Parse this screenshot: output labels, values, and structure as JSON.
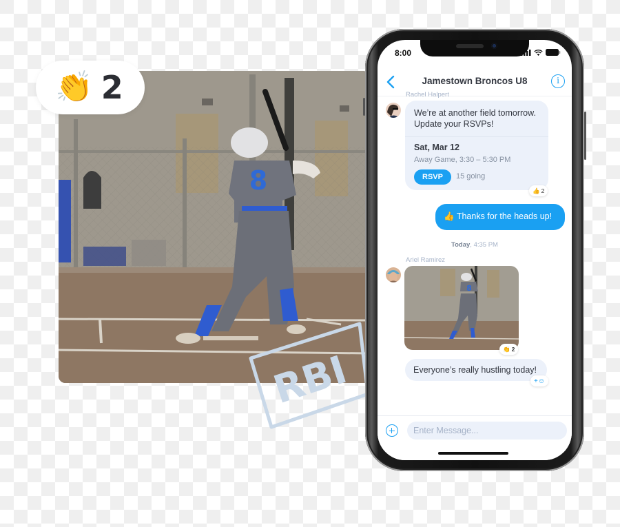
{
  "promo": {
    "clap_badge": {
      "emoji": "👏",
      "count": "2"
    },
    "stamp_text": "RBI",
    "player_number": "8"
  },
  "phone": {
    "status_bar": {
      "time": "8:00",
      "icons": [
        "cellular-signal-icon",
        "wifi-icon",
        "battery-icon"
      ]
    },
    "nav": {
      "back_icon": "chevron-left-icon",
      "title": "Jamestown Broncos U8",
      "info_icon": "info-icon"
    },
    "messages": [
      {
        "type": "event",
        "sender": "Rachel Halpert",
        "text": "We’re at another field tomorrow. Update your RSVPs!",
        "event": {
          "date": "Sat, Mar 12",
          "detail": "Away Game, 3:30 – 5:30 PM",
          "rsvp_label": "RSVP",
          "going": "15 going"
        },
        "reaction": {
          "emoji": "👍",
          "count": "2"
        }
      },
      {
        "type": "outgoing",
        "emoji": "👍",
        "text": "Thanks for the heads up!"
      },
      {
        "type": "day_divider",
        "day": "Today",
        "time": ", 4:35 PM"
      },
      {
        "type": "media",
        "sender": "Ariel Ramirez",
        "reaction": {
          "emoji": "👏",
          "count": "2"
        }
      },
      {
        "type": "text",
        "text": "Everyone’s really hustling today!",
        "add_reaction_label": "+☺"
      }
    ],
    "composer": {
      "placeholder": "Enter Message..."
    }
  },
  "colors": {
    "accent": "#1aa0f2",
    "incoming_bubble": "#ecf1fa",
    "sender_name": "#a6b3c8",
    "title_text": "#333740"
  }
}
